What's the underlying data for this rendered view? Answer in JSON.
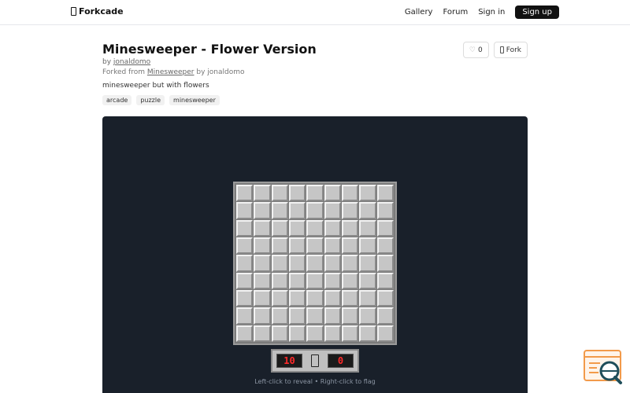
{
  "nav": {
    "brand": "Forkcade",
    "links": [
      "Gallery",
      "Forum",
      "Sign in"
    ],
    "signup": "Sign up"
  },
  "game": {
    "title": "Minesweeper - Flower Version",
    "by_prefix": "by",
    "author": "jonaldomo",
    "forked_prefix": "Forked from",
    "forked_from": "Minesweeper",
    "forked_by": "by jonaldomo",
    "description": "minesweeper but with flowers",
    "tags": [
      "arcade",
      "puzzle",
      "minesweeper"
    ],
    "likes": "0",
    "fork_label": "Fork"
  },
  "board": {
    "rows": 9,
    "cols": 9,
    "mines_counter": "10",
    "timer": "0",
    "hint": "Left-click to reveal • Right-click to flag"
  },
  "icons": {
    "brand": "brand-icon",
    "like": "heart-icon",
    "fork": "fork-icon",
    "face": "face-icon",
    "assistant": "assistant-widget-icon"
  },
  "colors": {
    "panel": "#19202a",
    "cell": "#c6c6c6",
    "lcd_text": "#ff2a2a",
    "signup_bg": "#111111"
  }
}
